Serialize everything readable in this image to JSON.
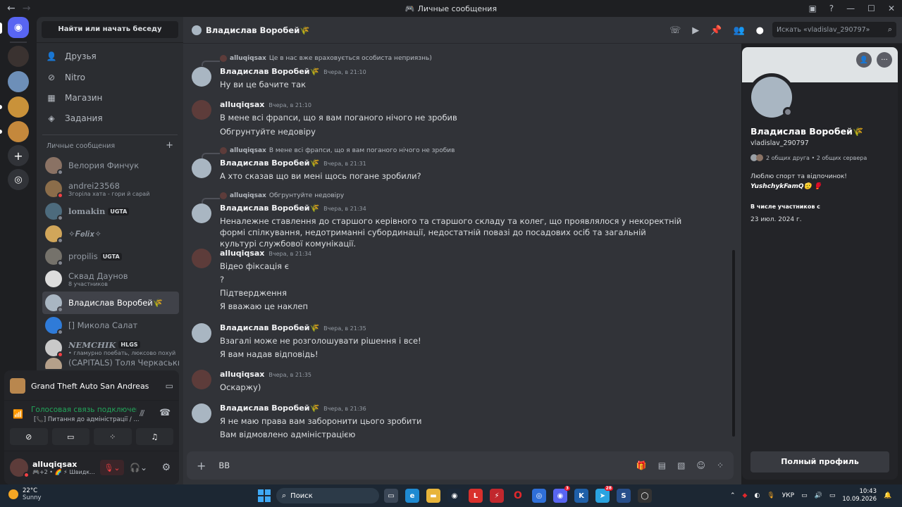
{
  "window": {
    "title": "Личные сообщения"
  },
  "sidebar": {
    "search_label": "Найти или начать беседу",
    "nav": [
      {
        "label": "Друзья",
        "icon": "friends-icon"
      },
      {
        "label": "Nitro",
        "icon": "nitro-icon"
      },
      {
        "label": "Магазин",
        "icon": "shop-icon"
      },
      {
        "label": "Задания",
        "icon": "quests-icon"
      }
    ],
    "dm_header": "Личные сообщения",
    "dms": [
      {
        "name": "Велория Финчук",
        "sub": "",
        "tag": ""
      },
      {
        "name": "andrei23568",
        "sub": "Згоріла хата - гори й сарай",
        "tag": ""
      },
      {
        "name": "lomakin",
        "sub": "",
        "tag": "UGTA"
      },
      {
        "name": "✧𝑭𝒆𝒍𝒊𝒙✧",
        "sub": "",
        "tag": ""
      },
      {
        "name": "propilis",
        "sub": "",
        "tag": "UGTA"
      },
      {
        "name": "Сквад Даунов",
        "sub": "8 участников",
        "tag": ""
      },
      {
        "name": "Владислав Воробей🌾",
        "sub": "",
        "tag": ""
      },
      {
        "name": "[] Микола Салат",
        "sub": "",
        "tag": ""
      },
      {
        "name": "NEMCHIK",
        "sub": "• гламурно поебать, люксово похуй",
        "tag": "HLGS"
      },
      {
        "name": "(CAPITALS) Толя Черкаський",
        "sub": "",
        "tag": ""
      }
    ]
  },
  "panel": {
    "game": "Grand Theft Auto San Andreas",
    "voice_status": "Голосовая связь подключена",
    "voice_channel": "[📞] Питання до адміністрації / ...",
    "user_name": "alluqiqsax",
    "user_status": "🎮+2 • 🌈 ⚡ Швидк..."
  },
  "chat": {
    "recipient": "Владислав Воробей🌾",
    "search_placeholder": "Искать «vladislav_290797»",
    "composer_text": "ВВ",
    "messages": [
      {
        "reply_author": "alluqiqsax",
        "reply_text": "Це в нас вже враховується особиста неприязнь)",
        "author": "Владислав Воробей🌾",
        "time": "Вчера, в 21:10",
        "lines": [
          "Ну ви це бачите так"
        ]
      },
      {
        "reply_author": "",
        "reply_text": "",
        "author": "alluqiqsax",
        "time": "Вчера, в 21:10",
        "lines": [
          "В мене всі фрапси, що я вам поганого нічого не зробив",
          "Обгрунтуйте недовіру"
        ]
      },
      {
        "reply_author": "alluqiqsax",
        "reply_text": "В мене всі фрапси, що я вам поганого нічого не зробив",
        "author": "Владислав Воробей🌾",
        "time": "Вчера, в 21:31",
        "lines": [
          "А хто сказав що ви мені щось погане зробили?"
        ]
      },
      {
        "reply_author": "alluqiqsax",
        "reply_text": "Обгрунтуйте недовіру",
        "author": "Владислав Воробей🌾",
        "time": "Вчера, в 21:34",
        "lines": [
          "Неналежне ставлення до старшого керівного та старшого складу та колег, що проявлялося у некоректній формі спілкування, недотриманні субординації, недостатній повазі до посадових осіб та загальній культурі службової комунікації."
        ]
      },
      {
        "reply_author": "",
        "reply_text": "",
        "author": "alluqiqsax",
        "time": "Вчера, в 21:34",
        "lines": [
          "Відео фіксація є",
          "?",
          "Підтвердження",
          "Я вважаю це наклеп"
        ]
      },
      {
        "reply_author": "",
        "reply_text": "",
        "author": "Владислав Воробей🌾",
        "time": "Вчера, в 21:35",
        "lines": [
          "Взагалі може не розголошувати рішення і все!",
          "Я вам надав відповідь!"
        ]
      },
      {
        "reply_author": "",
        "reply_text": "",
        "author": "alluqiqsax",
        "time": "Вчера, в 21:35",
        "lines": [
          "Оскаржу)"
        ]
      },
      {
        "reply_author": "",
        "reply_text": "",
        "author": "Владислав Воробей🌾",
        "time": "Вчера, в 21:36",
        "lines": [
          "Я не маю права вам заборонити цього зробити",
          "Вам відмовлено адміністрацією"
        ]
      }
    ]
  },
  "profile": {
    "name": "Владислав Воробей🌾",
    "username": "vladislav_290797",
    "mutuals": "2 общих друга • 2 общих сервера",
    "bio1": "Люблю спорт та відпочинок!",
    "bio2": "YushchykFamQ🫡 🥊",
    "member_since_label": "В числе участников с",
    "member_since": "23 июл. 2024 г.",
    "full_profile": "Полный профиль"
  },
  "taskbar": {
    "weather_temp": "22°C",
    "weather_desc": "Sunny",
    "search": "Поиск",
    "lang": "УКР",
    "time": "10:43",
    "date": "10.09.2026",
    "discord_badge": "3",
    "telegram_badge": "28"
  }
}
